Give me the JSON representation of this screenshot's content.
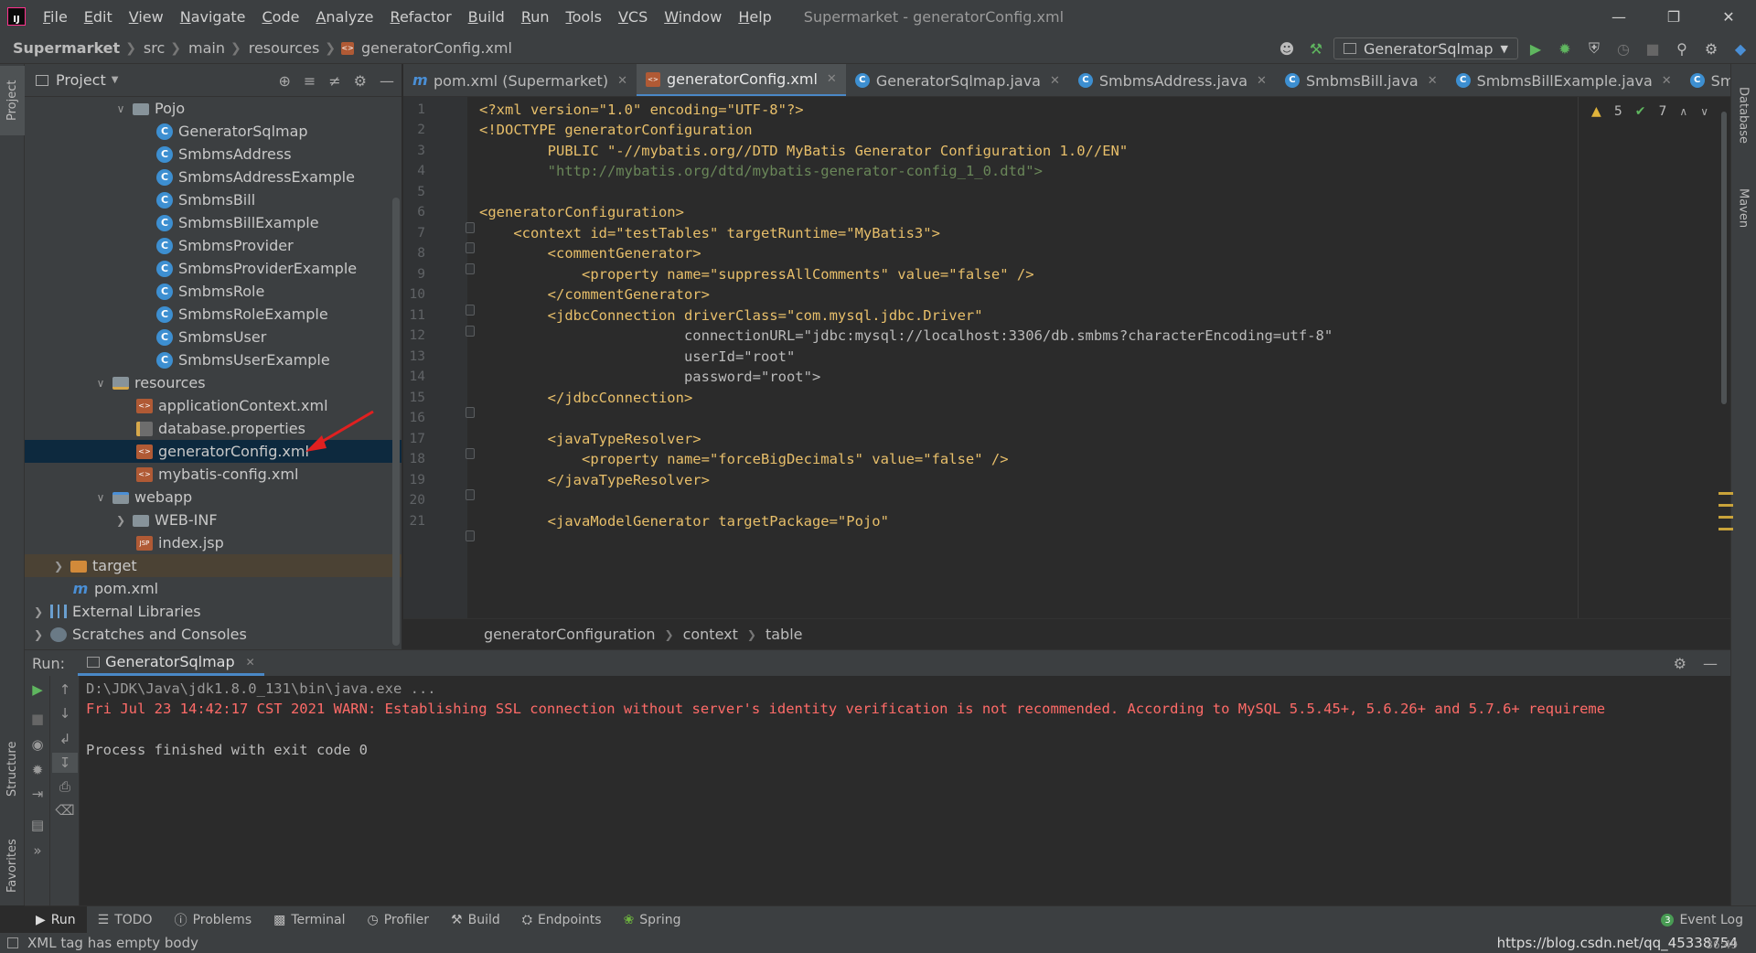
{
  "menubar": {
    "items": [
      "File",
      "Edit",
      "View",
      "Navigate",
      "Code",
      "Analyze",
      "Refactor",
      "Build",
      "Run",
      "Tools",
      "VCS",
      "Window",
      "Help"
    ],
    "window_title": "Supermarket - generatorConfig.xml"
  },
  "navbar": {
    "breadcrumbs": [
      "Supermarket",
      "src",
      "main",
      "resources",
      "generatorConfig.xml"
    ],
    "run_config": "GeneratorSqlmap"
  },
  "left_strip": {
    "project": "Project",
    "structure": "Structure",
    "favorites": "Favorites"
  },
  "right_strip": {
    "database": "Database",
    "maven": "Maven"
  },
  "project_panel": {
    "title": "Project",
    "tree": [
      {
        "label": "Pojo",
        "icon": "folder-icon",
        "expanded": true
      },
      {
        "label": "GeneratorSqlmap",
        "icon": "class-icon"
      },
      {
        "label": "SmbmsAddress",
        "icon": "class-icon"
      },
      {
        "label": "SmbmsAddressExample",
        "icon": "class-icon"
      },
      {
        "label": "SmbmsBill",
        "icon": "class-icon"
      },
      {
        "label": "SmbmsBillExample",
        "icon": "class-icon"
      },
      {
        "label": "SmbmsProvider",
        "icon": "class-icon"
      },
      {
        "label": "SmbmsProviderExample",
        "icon": "class-icon"
      },
      {
        "label": "SmbmsRole",
        "icon": "class-icon"
      },
      {
        "label": "SmbmsRoleExample",
        "icon": "class-icon"
      },
      {
        "label": "SmbmsUser",
        "icon": "class-icon"
      },
      {
        "label": "SmbmsUserExample",
        "icon": "class-icon"
      },
      {
        "label": "resources",
        "icon": "resources-folder-icon",
        "expanded": true
      },
      {
        "label": "applicationContext.xml",
        "icon": "xml-file-icon"
      },
      {
        "label": "database.properties",
        "icon": "properties-file-icon"
      },
      {
        "label": "generatorConfig.xml",
        "icon": "xml-file-icon",
        "selected": true
      },
      {
        "label": "mybatis-config.xml",
        "icon": "xml-file-icon"
      },
      {
        "label": "webapp",
        "icon": "web-folder-icon",
        "expanded": true
      },
      {
        "label": "WEB-INF",
        "icon": "folder-icon",
        "expanded": false
      },
      {
        "label": "index.jsp",
        "icon": "jsp-file-icon"
      },
      {
        "label": "target",
        "icon": "excluded-folder-icon",
        "expanded": false
      },
      {
        "label": "pom.xml",
        "icon": "maven-file-icon"
      },
      {
        "label": "External Libraries",
        "icon": "libraries-icon",
        "expanded": false
      },
      {
        "label": "Scratches and Consoles",
        "icon": "scratches-icon",
        "expanded": false
      }
    ]
  },
  "editor": {
    "tabs": [
      {
        "label": "pom.xml (Supermarket)",
        "icon": "maven-file-icon"
      },
      {
        "label": "generatorConfig.xml",
        "icon": "xml-file-icon",
        "active": true
      },
      {
        "label": "GeneratorSqlmap.java",
        "icon": "class-icon"
      },
      {
        "label": "SmbmsAddress.java",
        "icon": "class-icon"
      },
      {
        "label": "SmbmsBill.java",
        "icon": "class-icon"
      },
      {
        "label": "SmbmsBillExample.java",
        "icon": "class-icon"
      },
      {
        "label": "SmbmsUser.j",
        "icon": "class-icon"
      }
    ],
    "inspections": {
      "warnings": "5",
      "weak_warnings": "7"
    },
    "line_numbers": [
      "1",
      "2",
      "3",
      "4",
      "5",
      "6",
      "7",
      "8",
      "9",
      "10",
      "11",
      "12",
      "13",
      "14",
      "15",
      "16",
      "17",
      "18",
      "19",
      "20",
      "21"
    ],
    "lines": [
      "<?xml version=\"1.0\" encoding=\"UTF-8\"?>",
      "<!DOCTYPE generatorConfiguration",
      "        PUBLIC \"-//mybatis.org//DTD MyBatis Generator Configuration 1.0//EN\"",
      "        \"http://mybatis.org/dtd/mybatis-generator-config_1_0.dtd\">",
      "",
      "<generatorConfiguration>",
      "    <context id=\"testTables\" targetRuntime=\"MyBatis3\">",
      "        <commentGenerator>",
      "            <property name=\"suppressAllComments\" value=\"false\" />",
      "        </commentGenerator>",
      "        <jdbcConnection driverClass=\"com.mysql.jdbc.Driver\"",
      "                        connectionURL=\"jdbc:mysql://localhost:3306/db.smbms?characterEncoding=utf-8\"",
      "                        userId=\"root\"",
      "                        password=\"root\">",
      "        </jdbcConnection>",
      "",
      "        <javaTypeResolver>",
      "            <property name=\"forceBigDecimals\" value=\"false\" />",
      "        </javaTypeResolver>",
      "",
      "        <javaModelGenerator targetPackage=\"Pojo\""
    ],
    "breadcrumb": [
      "generatorConfiguration",
      "context",
      "table"
    ]
  },
  "run_panel": {
    "label": "Run:",
    "tab": "GeneratorSqlmap",
    "console": {
      "cmd": "D:\\JDK\\Java\\jdk1.8.0_131\\bin\\java.exe ...",
      "warn": "Fri Jul 23 14:42:17 CST 2021 WARN: Establishing SSL connection without server's identity verification is not recommended. According to MySQL 5.5.45+, 5.6.26+ and 5.7.6+ requireme",
      "exit": "Process finished with exit code 0"
    }
  },
  "toolwindows": {
    "items": [
      "Run",
      "TODO",
      "Problems",
      "Terminal",
      "Profiler",
      "Build",
      "Endpoints",
      "Spring"
    ],
    "event_log": "Event Log",
    "event_count": "3"
  },
  "statusbar": {
    "message": "XML tag has empty body",
    "watermark": "https://blog.csdn.net/qq_45338754",
    "time": "36:49"
  }
}
